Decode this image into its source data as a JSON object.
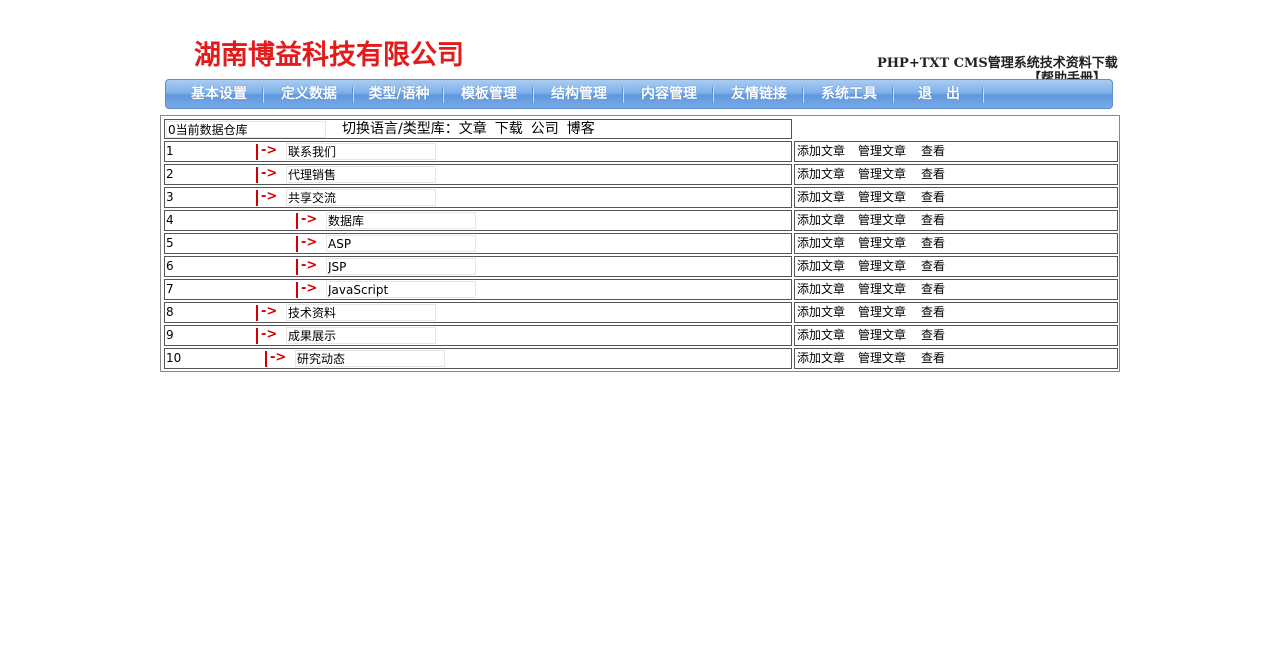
{
  "header": {
    "logo": "湖南博益科技有限公司",
    "site_title": "PHP+TXT CMS管理系统技术资料下载",
    "help_link": "【帮助手册】"
  },
  "nav": [
    "基本设置",
    "定义数据",
    "类型/语种",
    "模板管理",
    "结构管理",
    "内容管理",
    "友情链接",
    "系统工具",
    "退　出"
  ],
  "top_row": {
    "input_value": "0当前数据仓库",
    "switch_label": "切换语言/类型库：",
    "links": [
      "文章",
      "下载",
      "公司",
      "博客"
    ]
  },
  "actions": {
    "add": "添加文章",
    "manage": "管理文章",
    "view": "查看"
  },
  "rows": [
    {
      "id": "1",
      "name": "联系我们"
    },
    {
      "id": "2",
      "name": "代理销售"
    },
    {
      "id": "3",
      "name": "共享交流"
    },
    {
      "id": "4",
      "name": "数据库"
    },
    {
      "id": "5",
      "name": "ASP"
    },
    {
      "id": "6",
      "name": "JSP"
    },
    {
      "id": "7",
      "name": "JavaScript"
    },
    {
      "id": "8",
      "name": "技术资料"
    },
    {
      "id": "9",
      "name": "成果展示"
    },
    {
      "id": "10",
      "name": "研究动态"
    }
  ],
  "colors": {
    "accent_red": "#e31b1b",
    "nav_blue": "#6fa3e3",
    "arrow_red": "#d40000"
  }
}
